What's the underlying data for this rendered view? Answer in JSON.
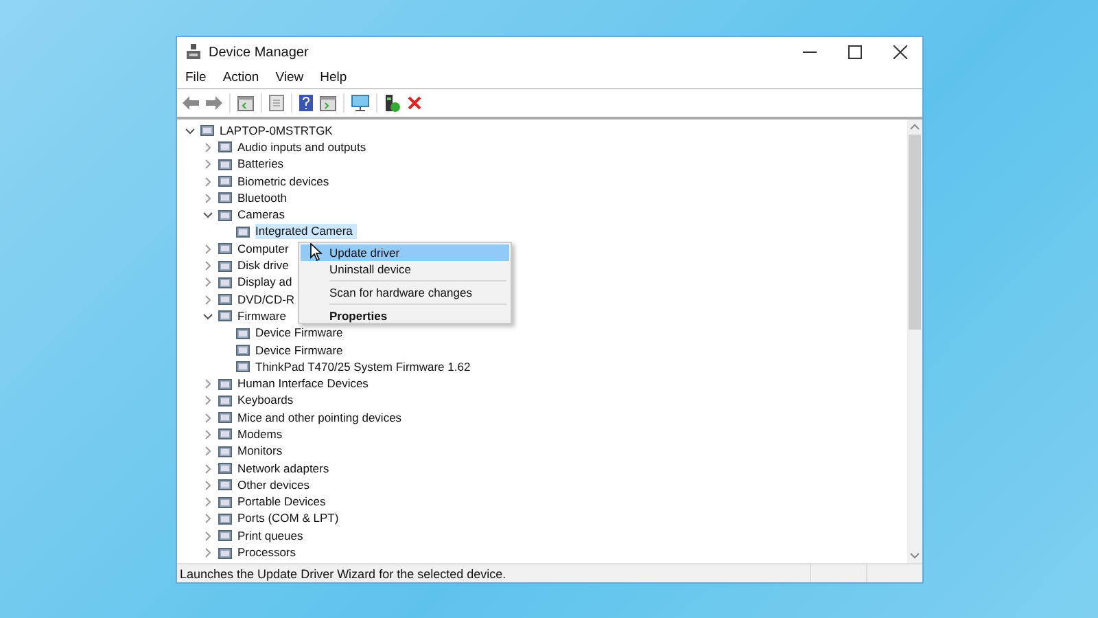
{
  "window": {
    "title": "Device Manager"
  },
  "menu_bar": [
    "File",
    "Action",
    "View",
    "Help"
  ],
  "tree": {
    "label": "LAPTOP-0MSTRTGK",
    "expanded": true,
    "children": [
      {
        "label": "Audio inputs and outputs",
        "expanded": false
      },
      {
        "label": "Batteries",
        "expanded": false
      },
      {
        "label": "Biometric devices",
        "expanded": false
      },
      {
        "label": "Bluetooth",
        "expanded": false
      },
      {
        "label": "Cameras",
        "expanded": true,
        "children": [
          {
            "label": "Integrated Camera",
            "selected": true
          }
        ]
      },
      {
        "label": "Computer",
        "expanded": false
      },
      {
        "label": "Disk drive",
        "expanded": false
      },
      {
        "label": "Display ad",
        "expanded": false
      },
      {
        "label": "DVD/CD-R",
        "expanded": false
      },
      {
        "label": "Firmware",
        "expanded": true,
        "children": [
          {
            "label": "Device Firmware",
            "selected": false
          },
          {
            "label": "Device Firmware",
            "selected": false
          },
          {
            "label": "ThinkPad T470/25 System Firmware 1.62",
            "selected": false
          }
        ]
      },
      {
        "label": "Human Interface Devices",
        "expanded": false
      },
      {
        "label": "Keyboards",
        "expanded": false
      },
      {
        "label": "Mice and other pointing devices",
        "expanded": false
      },
      {
        "label": "Modems",
        "expanded": false
      },
      {
        "label": "Monitors",
        "expanded": false
      },
      {
        "label": "Network adapters",
        "expanded": false
      },
      {
        "label": "Other devices",
        "expanded": false
      },
      {
        "label": "Portable Devices",
        "expanded": false
      },
      {
        "label": "Ports (COM & LPT)",
        "expanded": false
      },
      {
        "label": "Print queues",
        "expanded": false
      },
      {
        "label": "Processors",
        "expanded": false
      }
    ]
  },
  "context_menu": [
    {
      "kind": "item",
      "label": "Update driver",
      "selected": true
    },
    {
      "kind": "item",
      "label": "Uninstall device",
      "selected": false
    },
    {
      "kind": "separator"
    },
    {
      "kind": "item",
      "label": "Scan for hardware changes",
      "selected": false
    },
    {
      "kind": "separator"
    },
    {
      "kind": "default",
      "label": "Properties",
      "selected": false
    }
  ],
  "status_bar": "Launches the Update Driver Wizard for the selected device."
}
